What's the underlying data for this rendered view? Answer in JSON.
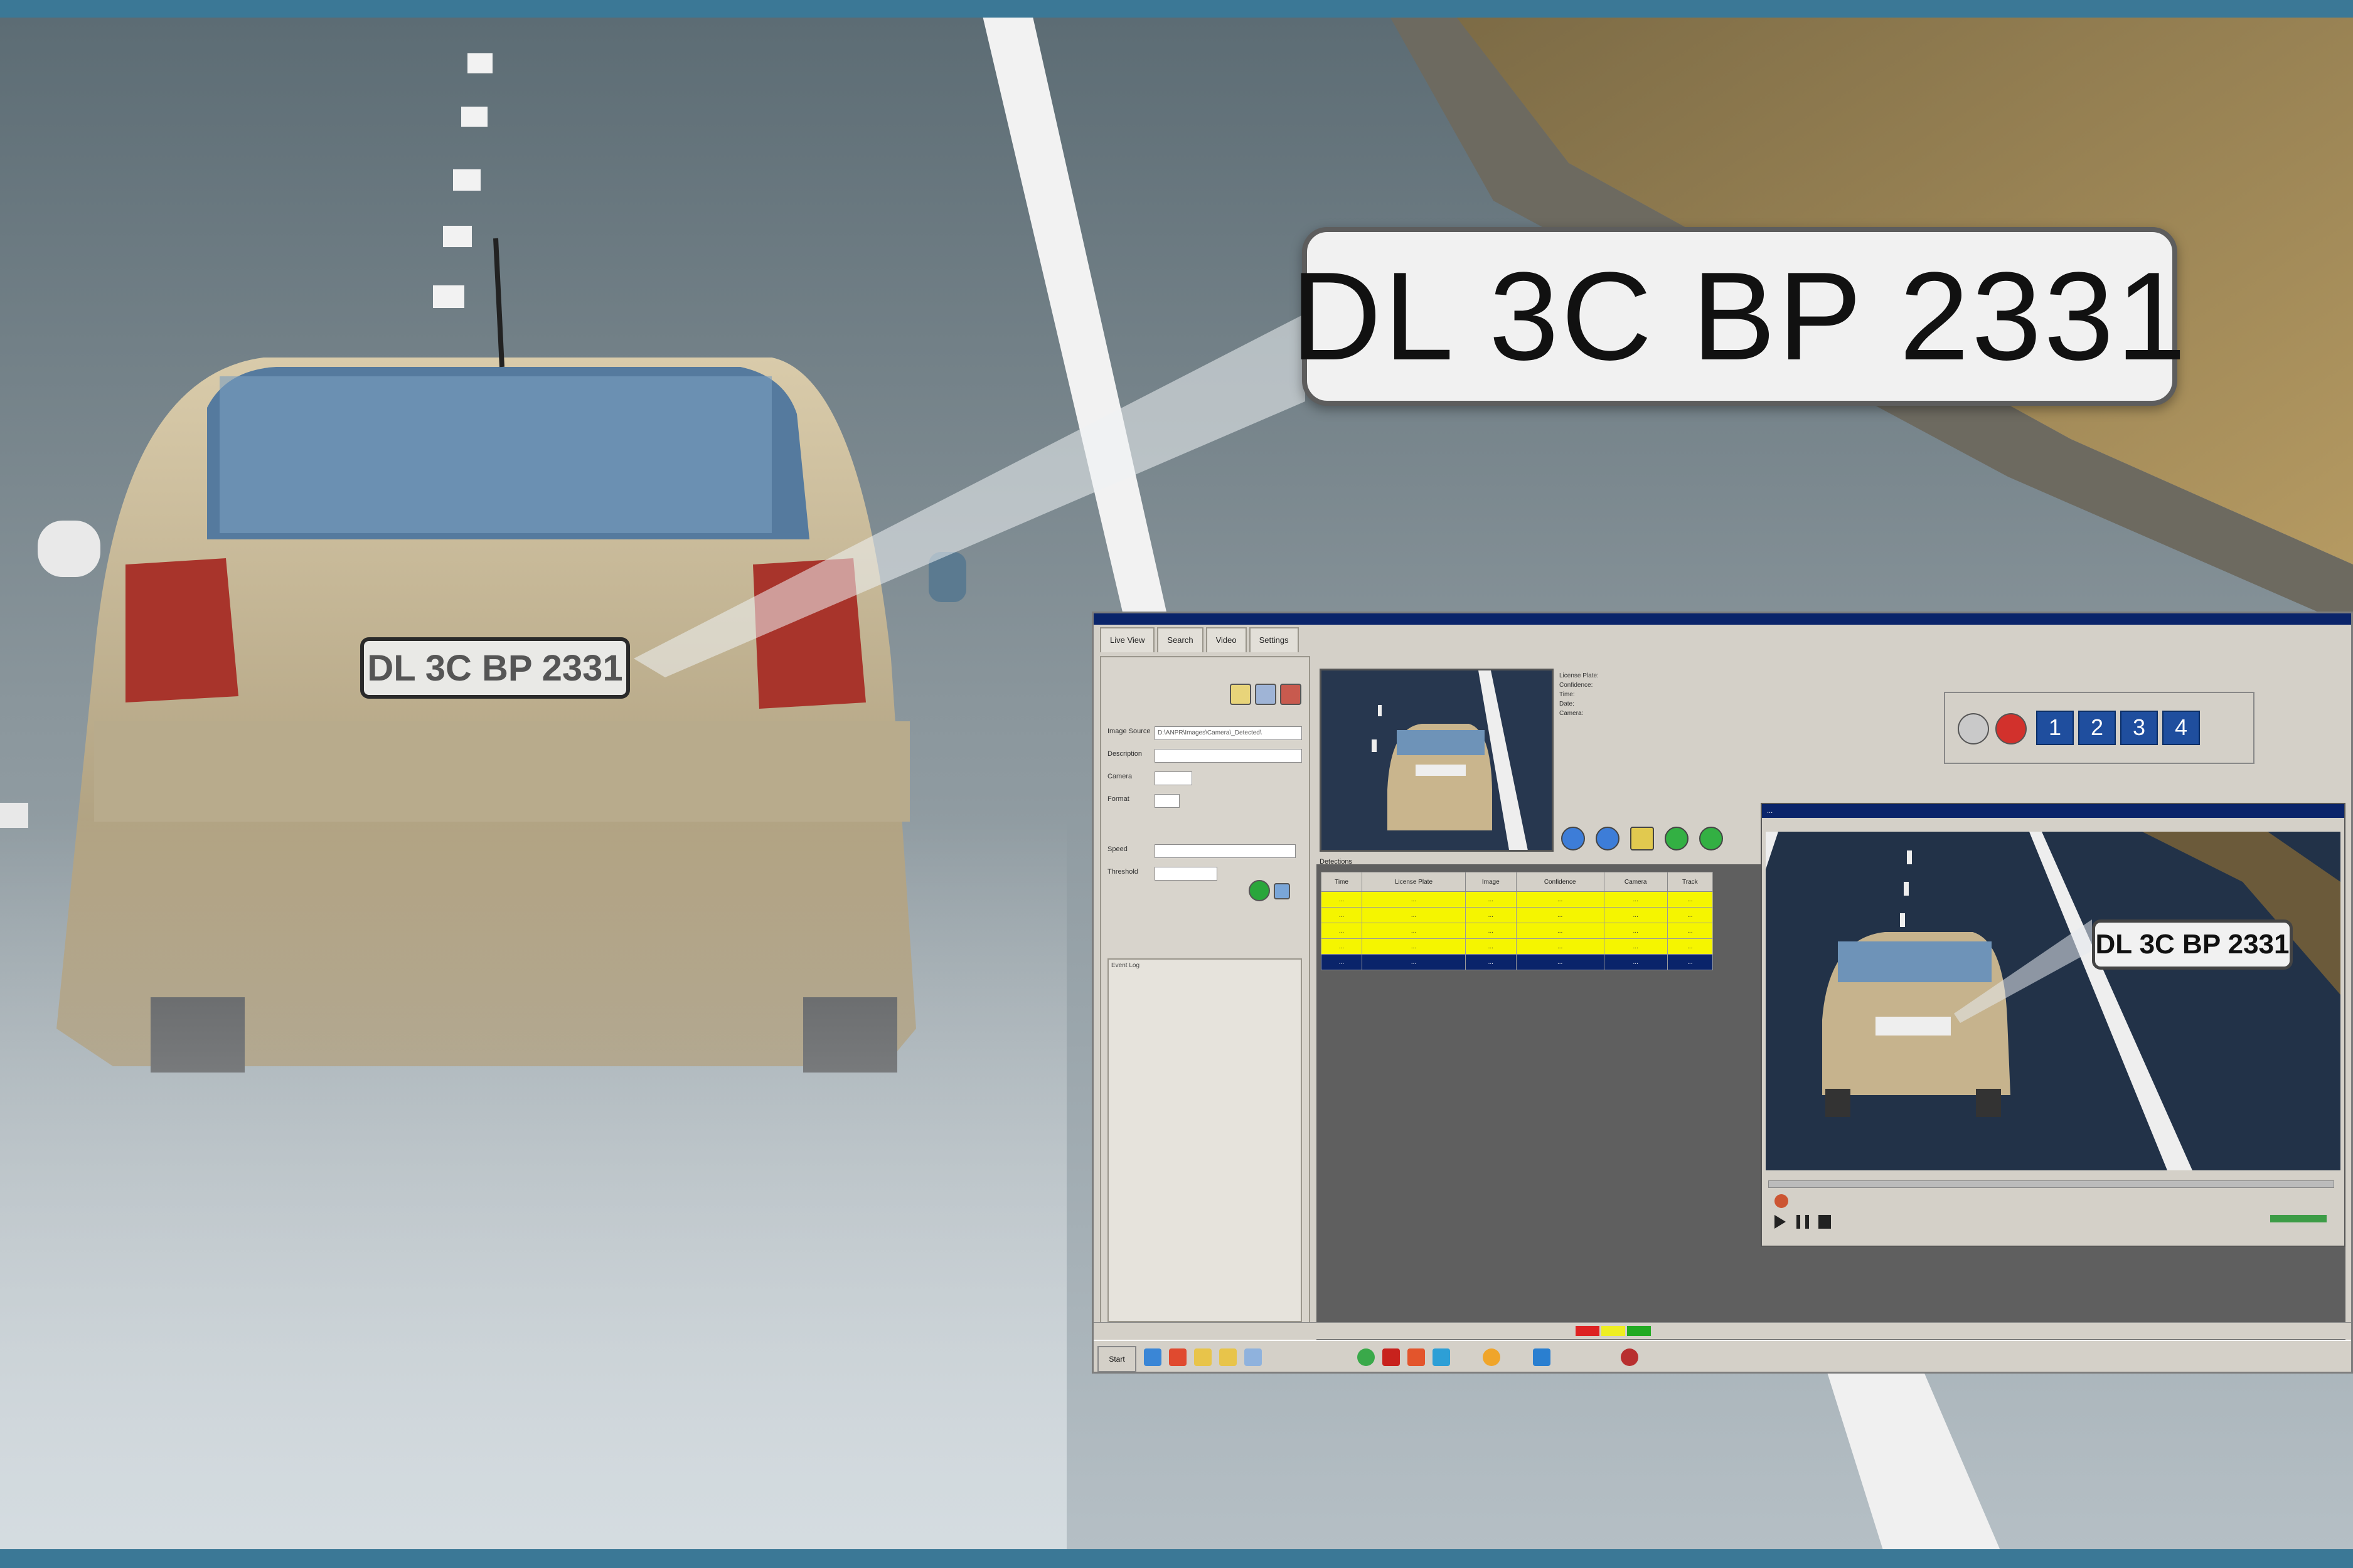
{
  "plate_callout": {
    "text": "DL 3C BP 2331"
  },
  "plate_on_car": {
    "text": "DL 3C BP 2331"
  },
  "app": {
    "tabs": [
      "Live View",
      "Search",
      "Video",
      "Settings"
    ],
    "left_panel": {
      "rows": [
        "Image Source",
        "Description",
        "Camera",
        "Format",
        "Speed",
        "Threshold"
      ],
      "fields": [
        "D:\\ANPR\\Images\\Camera\\_Detected\\",
        "",
        "",
        "",
        "",
        ""
      ],
      "log_title": "Event Log"
    },
    "info_lines": [
      "License Plate:",
      "Confidence:",
      "Time:",
      "Date:",
      "Camera:"
    ],
    "detections_label": "Detections",
    "table": {
      "headers": [
        "Time",
        "License Plate",
        "Image",
        "Confidence",
        "Camera",
        "Track"
      ],
      "rows": [
        [
          "...",
          "...",
          "...",
          "...",
          "...",
          "..."
        ],
        [
          "...",
          "...",
          "...",
          "...",
          "...",
          "..."
        ],
        [
          "...",
          "...",
          "...",
          "...",
          "...",
          "..."
        ],
        [
          "...",
          "...",
          "...",
          "...",
          "...",
          "..."
        ],
        [
          "...",
          "...",
          "...",
          "...",
          "...",
          "..."
        ]
      ]
    },
    "toolbox_numbers": [
      "1",
      "2",
      "3",
      "4"
    ],
    "player": {
      "title": "...",
      "plate_text": "DL 3C BP 2331"
    },
    "taskbar": {
      "start": "Start"
    }
  },
  "colors": {
    "accent_blue": "#3b7896",
    "table_highlight": "#f5f500",
    "selected_row": "#0a246a"
  }
}
